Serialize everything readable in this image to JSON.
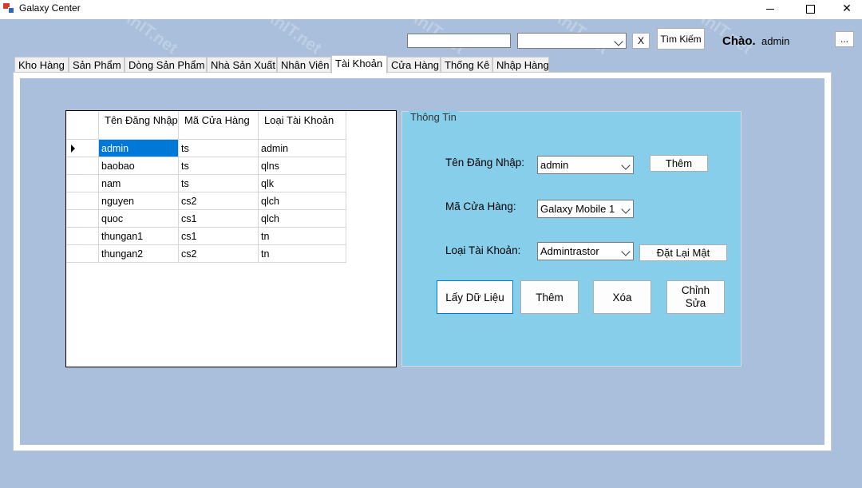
{
  "window": {
    "title": "Galaxy Center",
    "min": "—",
    "close": "✕"
  },
  "toolbar": {
    "search_value": "",
    "filter_value": "",
    "clear_label": "X",
    "search_label": "Tìm Kiếm",
    "greeting": "Chào.",
    "user": "admin",
    "more_label": "..."
  },
  "tabs": [
    {
      "label": "Kho Hàng"
    },
    {
      "label": "Sản Phẩm"
    },
    {
      "label": "Dòng Sản Phẩm"
    },
    {
      "label": "Nhà Sản Xuất"
    },
    {
      "label": "Nhân Viên"
    },
    {
      "label": "Tài Khoản"
    },
    {
      "label": "Cửa Hàng"
    },
    {
      "label": "Thống Kê"
    },
    {
      "label": "Nhập Hàng"
    }
  ],
  "grid": {
    "columns": [
      "Tên Đăng Nhập",
      "Mã Cửa Hàng",
      "Loại Tài Khoản"
    ],
    "rows": [
      [
        "admin",
        "ts",
        "admin"
      ],
      [
        "baobao",
        "ts",
        "qlns"
      ],
      [
        "nam",
        "ts",
        "qlk"
      ],
      [
        "nguyen",
        "cs2",
        "qlch"
      ],
      [
        "quoc",
        "cs1",
        "qlch"
      ],
      [
        "thungan1",
        "cs1",
        "tn"
      ],
      [
        "thungan2",
        "cs2",
        "tn"
      ]
    ]
  },
  "info": {
    "legend": "Thông Tin",
    "username_label": "Tên Đăng Nhập:",
    "username_value": "admin",
    "add_small_label": "Thêm",
    "store_label": "Mã Cửa Hàng:",
    "store_value": "Galaxy Mobile 1",
    "type_label": "Loại Tài Khoản:",
    "type_value": "Admintrastor",
    "reset_password_label": "Đặt Lại Mật",
    "load_label": "Lấy Dữ Liệu",
    "add_label": "Thêm",
    "delete_label": "Xóa",
    "edit_label": "Chỉnh Sửa"
  },
  "watermark": "DoAnIT.net",
  "colors": {
    "background": "#a9bfdc",
    "info_panel": "#87ceeb",
    "selection": "#0078d7"
  }
}
